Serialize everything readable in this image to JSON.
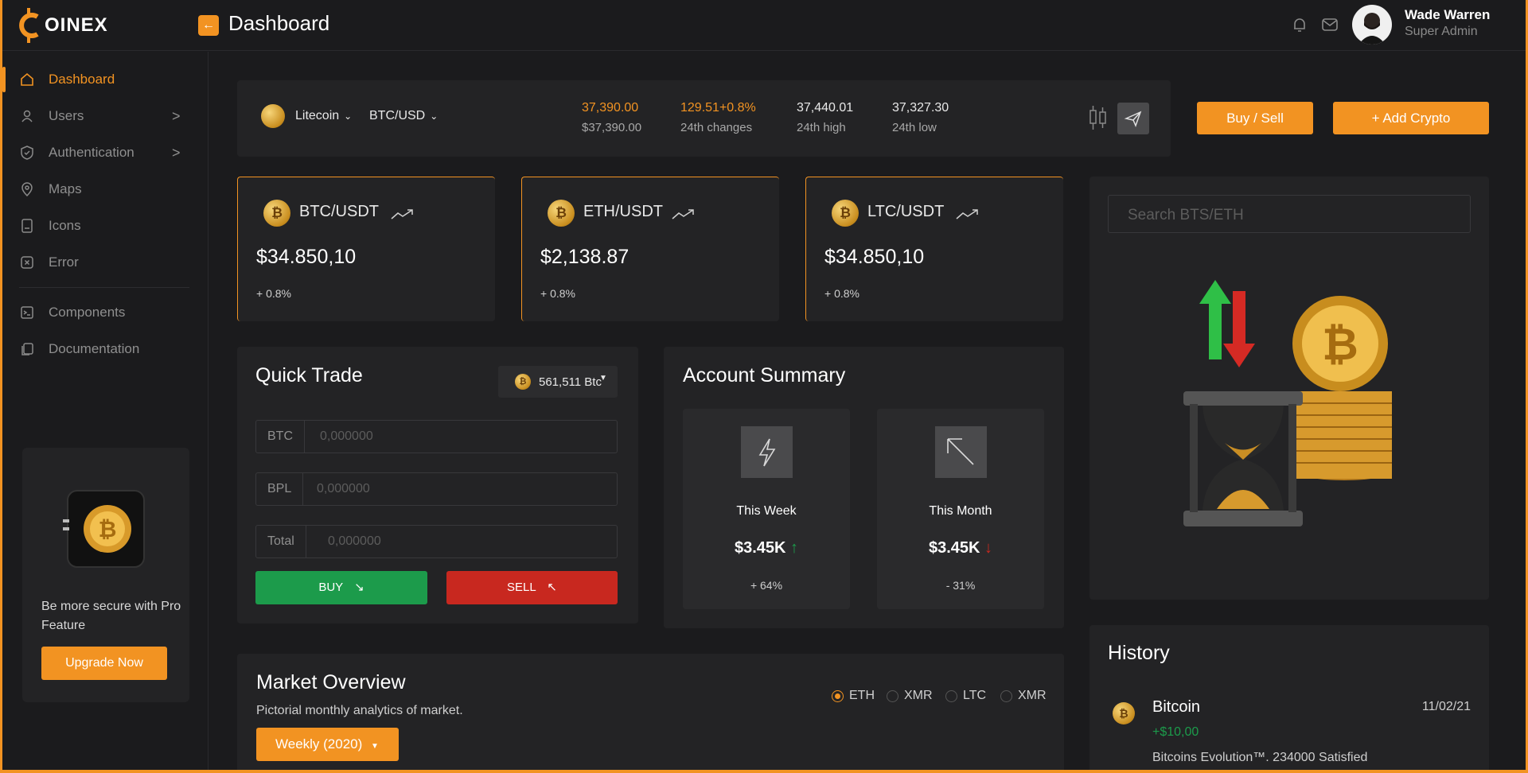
{
  "header": {
    "logo_text": "OINEX",
    "page_title": "Dashboard",
    "user": {
      "name": "Wade Warren",
      "role": "Super Admin"
    }
  },
  "sidebar": {
    "items": [
      {
        "label": "Dashboard",
        "active": true
      },
      {
        "label": "Users",
        "chevron": ">"
      },
      {
        "label": "Authentication",
        "chevron": ">"
      },
      {
        "label": "Maps"
      },
      {
        "label": "Icons"
      },
      {
        "label": "Error"
      },
      {
        "label": "Components"
      },
      {
        "label": "Documentation"
      }
    ],
    "promo": {
      "text": "Be more secure with Pro Feature",
      "button": "Upgrade Now"
    }
  },
  "ticker": {
    "coin": "Litecoin",
    "pair": "BTC/USD",
    "price": "37,390.00",
    "price_sub": "$37,390.00",
    "change": "129.51+0.8%",
    "change_label": "24th changes",
    "high": "37,440.01",
    "high_label": "24th high",
    "low": "37,327.30",
    "low_label": "24th low",
    "buy_sell": "Buy / Sell",
    "add_crypto": "+ Add Crypto"
  },
  "pairs": [
    {
      "name": "BTC/USDT",
      "value": "$34.850,10",
      "change": "+ 0.8%"
    },
    {
      "name": "ETH/USDT",
      "value": "$2,138.87",
      "change": "+ 0.8%"
    },
    {
      "name": "LTC/USDT",
      "value": "$34.850,10",
      "change": "+ 0.8%"
    }
  ],
  "quick_trade": {
    "title": "Quick Trade",
    "balance": "561,511 Btc",
    "fields": [
      {
        "label": "BTC",
        "value": "0,000000"
      },
      {
        "label": "BPL",
        "value": "0,000000"
      },
      {
        "label": "Total",
        "value": "0,000000"
      }
    ],
    "buy": "BUY",
    "sell": "SELL"
  },
  "account_summary": {
    "title": "Account Summary",
    "week": {
      "label": "This Week",
      "value": "$3.45K",
      "change": "+ 64%"
    },
    "month": {
      "label": "This Month",
      "value": "$3.45K",
      "change": "- 31%"
    }
  },
  "search": {
    "placeholder": "Search BTS/ETH"
  },
  "market": {
    "title": "Market Overview",
    "subtitle": "Pictorial monthly analytics of market.",
    "dropdown": "Weekly (2020)",
    "options": [
      "ETH",
      "XMR",
      "LTC",
      "XMR"
    ]
  },
  "history": {
    "title": "History",
    "item": {
      "name": "Bitcoin",
      "amount": "+$10,00",
      "date": "11/02/21",
      "desc": "Bitcoins Evolution™. 234000 Satisfied"
    }
  },
  "colors": {
    "accent": "#f29322",
    "buy": "#1c9b4b",
    "sell": "#c8281f",
    "bg": "#1b1b1d",
    "card": "#232325"
  }
}
